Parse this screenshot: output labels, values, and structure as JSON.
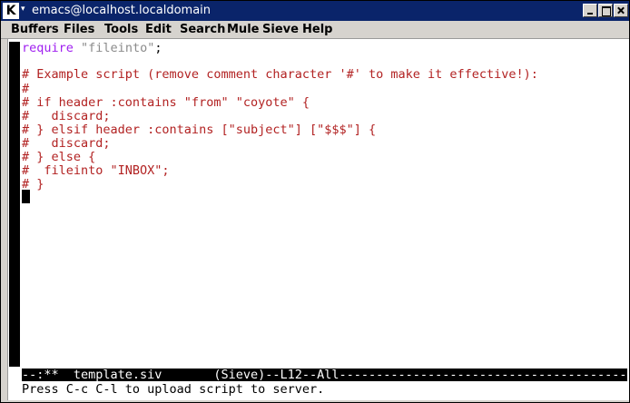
{
  "window": {
    "title": "emacs@localhost.localdomain",
    "icon": "kde-k-icon",
    "controls": [
      "minimize-icon",
      "maximize-icon",
      "close-icon"
    ]
  },
  "menubar": {
    "items": [
      "Buffers",
      "Files",
      "Tools",
      "Edit",
      "Search",
      "Mule",
      "Sieve",
      "Help"
    ]
  },
  "editor": {
    "lines": [
      {
        "kw": "require",
        "str": "\"fileinto\"",
        "rest": ";"
      },
      {
        "text": ""
      },
      {
        "text": "# Example script (remove comment character '#' to make it effective!):"
      },
      {
        "text": "#"
      },
      {
        "text": "# if header :contains \"from\" \"coyote\" {"
      },
      {
        "text": "#   discard;"
      },
      {
        "text": "# } elsif header :contains [\"subject\"] [\"$$$\"] {"
      },
      {
        "text": "#   discard;"
      },
      {
        "text": "# } else {"
      },
      {
        "text": "#  fileinto \"INBOX\";"
      },
      {
        "text": "# }"
      }
    ],
    "colors": {
      "keyword": "#a020f0",
      "string": "#8b8b8b",
      "comment": "#b22222"
    }
  },
  "modeline": {
    "text": "--:**  template.siv       (Sieve)--L12--All-----------------------------------------"
  },
  "echo": {
    "text": "Press C-c C-l to upload script to server."
  }
}
